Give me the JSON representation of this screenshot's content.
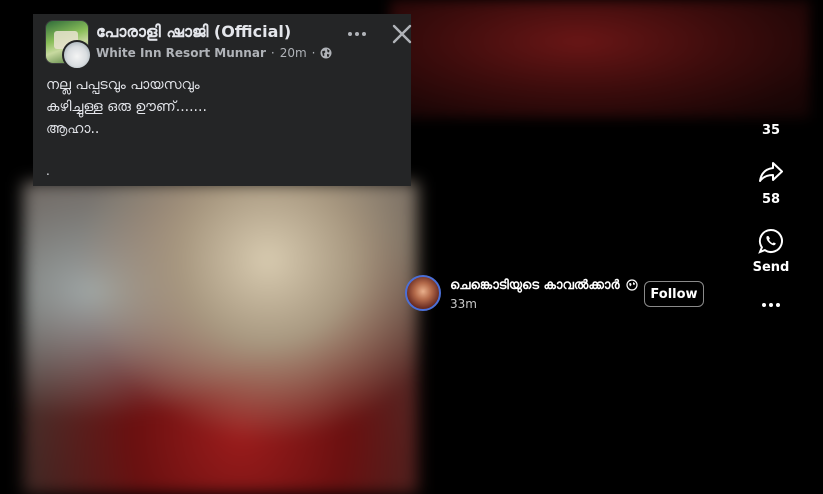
{
  "post": {
    "page_name": "പോരാളി ഷാജി (Official)",
    "source": "White Inn Resort Munnar",
    "time": "20m",
    "separator": "·",
    "body_lines": [
      "നല്ല പപ്പടവും പായസവും",
      "കഴിച്ചുള്ള ഒരു ഊണ്.......",
      "ആഹാ.."
    ],
    "trailing": "."
  },
  "icons": {
    "globe": "globe-icon",
    "more": "more-horizontal-icon",
    "close": "close-icon",
    "share": "share-icon",
    "send": "whatsapp-icon",
    "dots": "more-dots-icon"
  },
  "actions": {
    "top_count": "35",
    "share_count": "58",
    "send_label": "Send"
  },
  "reel": {
    "author": "ചെങ്കൊടിയുടെ കാവൽക്കാർ",
    "time": "33m",
    "follow_label": "Follow"
  },
  "colors": {
    "background": "#000000",
    "card": "#242526",
    "text_primary": "#e4e6eb",
    "text_secondary": "#b0b3b8",
    "avatar_ring": "#4b6fd6"
  }
}
